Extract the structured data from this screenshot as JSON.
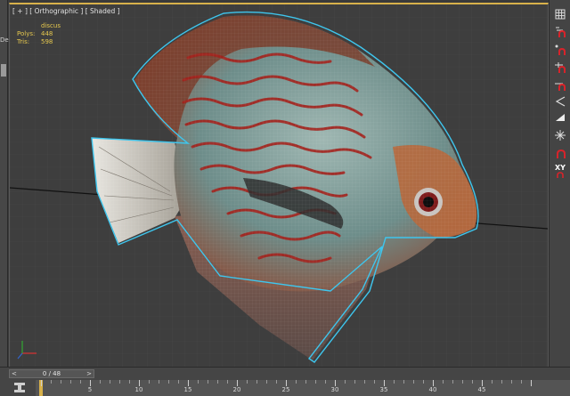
{
  "left_panel": {
    "label": "De"
  },
  "viewport": {
    "label": "[ + ] [ Orthographic ] [ Shaded ]",
    "stats": {
      "object_name": "discus",
      "rows": [
        {
          "key": "Polys:",
          "value": "448"
        },
        {
          "key": "Tris:",
          "value": "598"
        }
      ]
    },
    "axis_labels": {
      "x": "X",
      "y": "Y",
      "z": "Z"
    }
  },
  "right_toolbar": {
    "tools": [
      {
        "name": "grid-icon"
      },
      {
        "name": "snap-magnet-icon"
      },
      {
        "name": "snap-magnet-icon"
      },
      {
        "name": "snap-magnet-icon"
      },
      {
        "name": "snap-magnet-icon"
      },
      {
        "name": "angle-snap-icon"
      },
      {
        "name": "bevel-icon"
      },
      {
        "name": "snowflake-snap-icon"
      },
      {
        "name": "snap-magnet-icon"
      },
      {
        "name": "xy-plane-icon",
        "text": "XY"
      }
    ]
  },
  "timeline": {
    "frame_display": "0 / 48",
    "prev_arrow": "<",
    "next_arrow": ">",
    "ruler_labels": [
      "5",
      "10",
      "15",
      "20",
      "25",
      "30",
      "35",
      "40",
      "45"
    ]
  },
  "colors": {
    "selection_outline": "#3ec6ee",
    "accent": "#d8b14a",
    "stats_text": "#e6c84e",
    "magnet_red": "#d8232a"
  }
}
